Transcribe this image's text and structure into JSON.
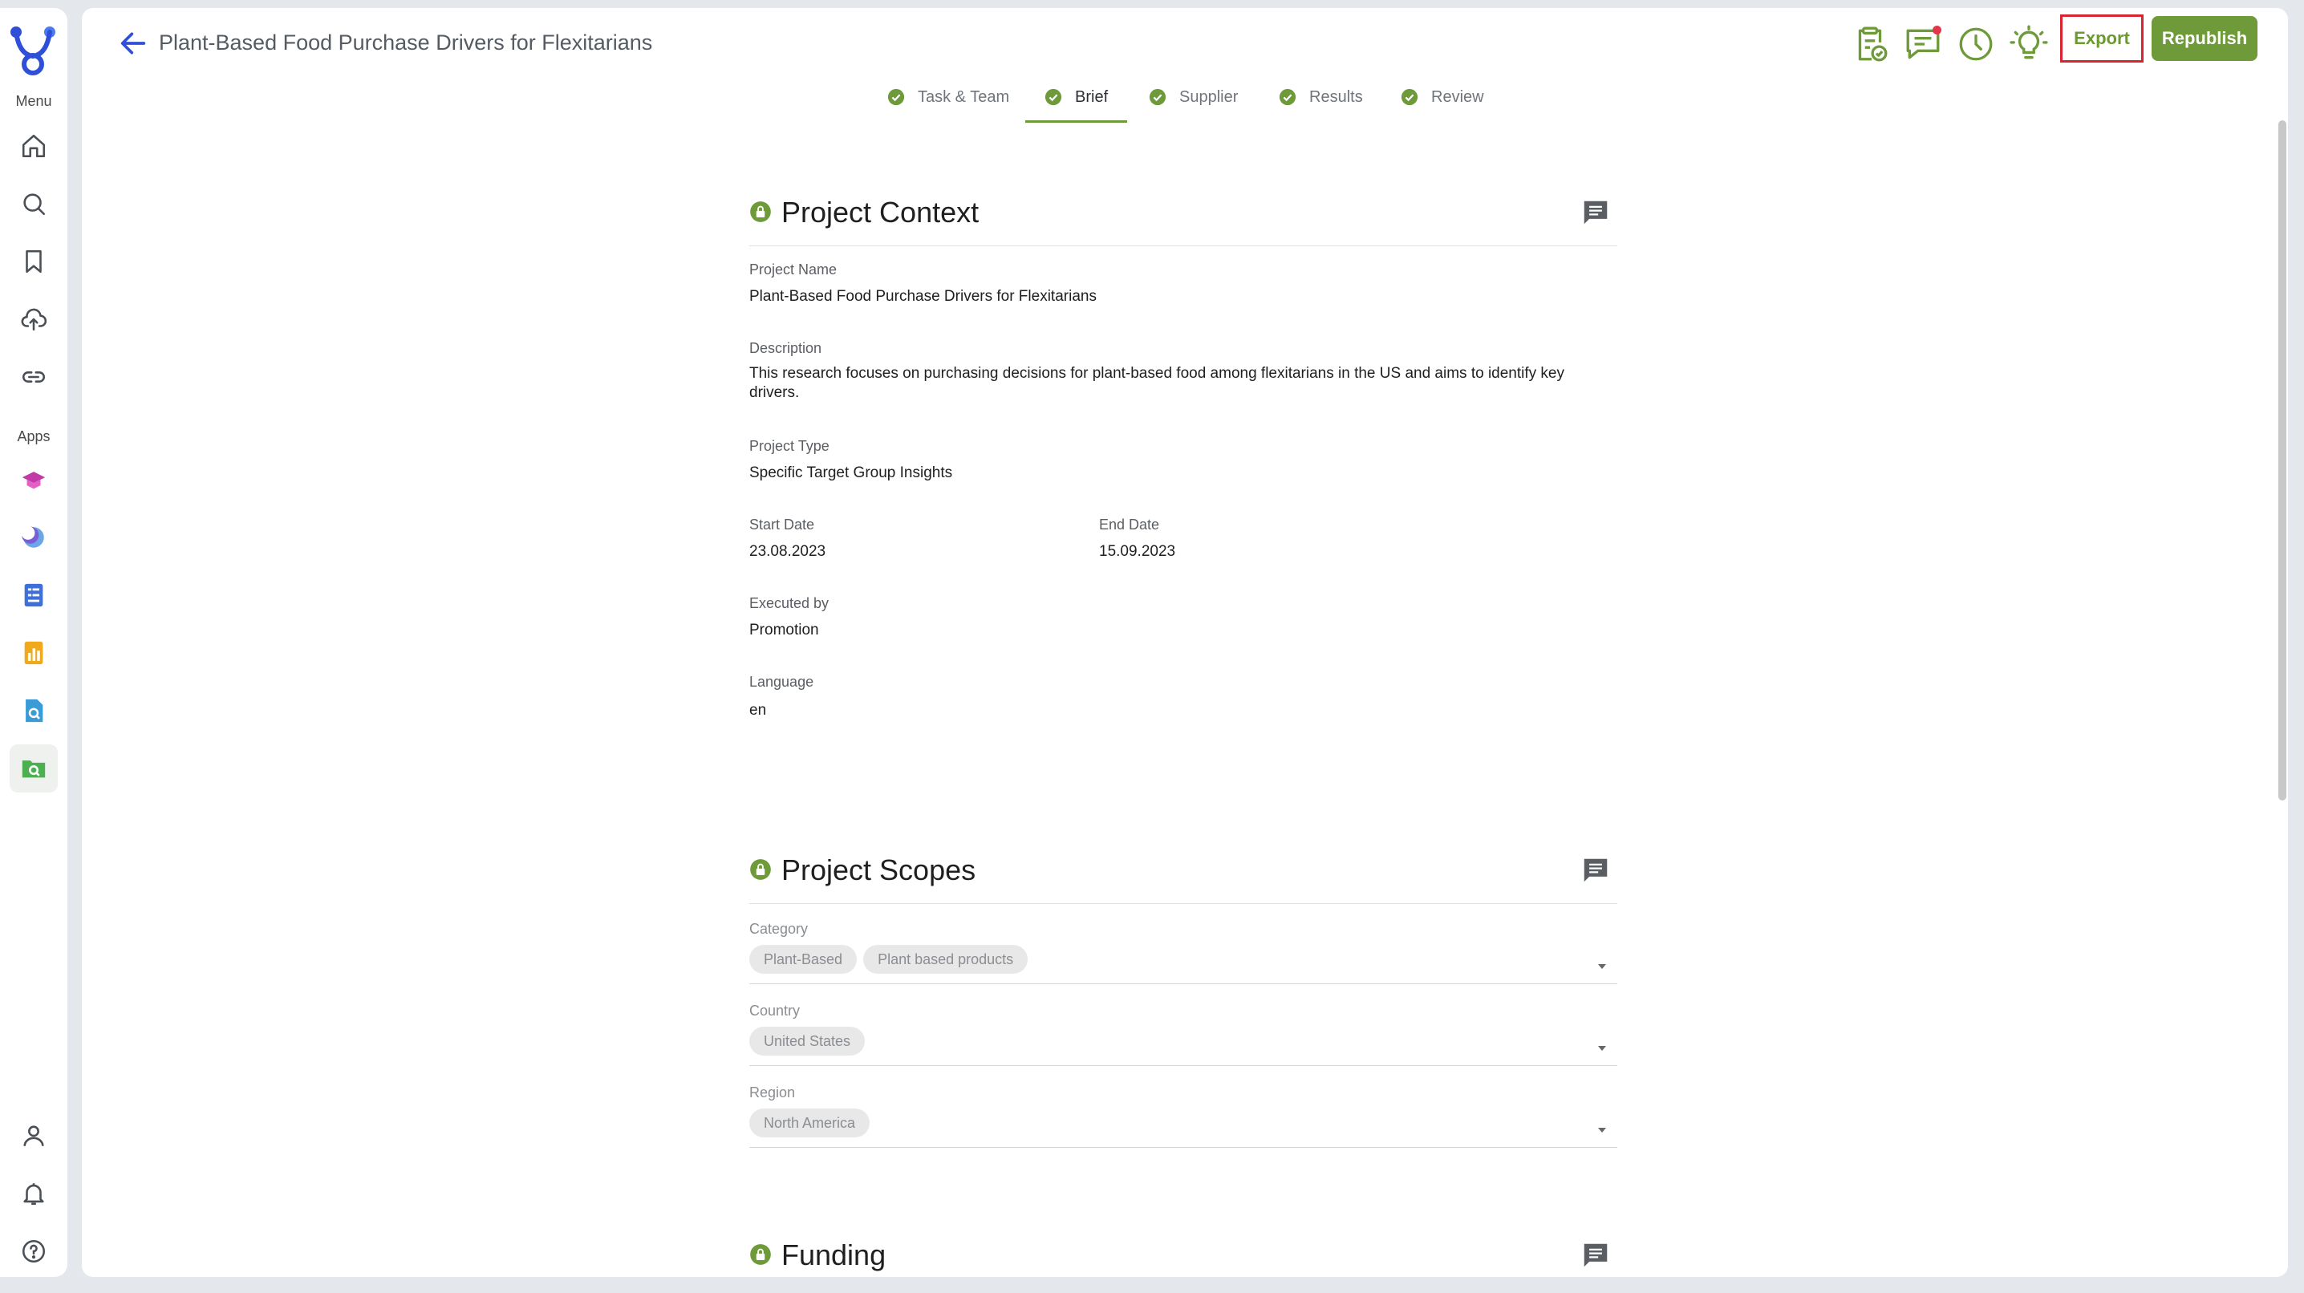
{
  "sidebar": {
    "menu_label": "Menu",
    "apps_label": "Apps",
    "menu_items": [
      {
        "name": "home-icon"
      },
      {
        "name": "search-icon"
      },
      {
        "name": "bookmark-icon"
      },
      {
        "name": "upload-icon"
      },
      {
        "name": "link-icon"
      }
    ],
    "app_items": [
      {
        "name": "graduation-cap-app-icon"
      },
      {
        "name": "moon-app-icon"
      },
      {
        "name": "document-list-app-icon"
      },
      {
        "name": "bar-chart-app-icon"
      },
      {
        "name": "document-search-app-icon"
      },
      {
        "name": "folder-search-app-icon"
      }
    ],
    "bottom_items": [
      {
        "name": "profile-icon"
      },
      {
        "name": "bell-icon"
      },
      {
        "name": "help-icon"
      }
    ]
  },
  "header": {
    "title": "Plant-Based Food Purchase Drivers for Flexitarians",
    "export_label": "Export",
    "republish_label": "Republish",
    "icons": [
      "clipboard-check-icon",
      "chat-icon",
      "clock-icon",
      "lightbulb-icon"
    ]
  },
  "tabs": [
    {
      "label": "Task & Team"
    },
    {
      "label": "Brief",
      "active": true
    },
    {
      "label": "Supplier"
    },
    {
      "label": "Results"
    },
    {
      "label": "Review"
    }
  ],
  "project_context": {
    "title": "Project Context",
    "project_name_label": "Project Name",
    "project_name": "Plant-Based Food Purchase Drivers for Flexitarians",
    "description_label": "Description",
    "description": "This research focuses on purchasing decisions for plant-based food among flexitarians in the US and aims to identify key drivers.",
    "project_type_label": "Project Type",
    "project_type": "Specific Target Group Insights",
    "start_date_label": "Start Date",
    "start_date": "23.08.2023",
    "end_date_label": "End Date",
    "end_date": "15.09.2023",
    "executed_by_label": "Executed by",
    "executed_by": "Promotion",
    "language_label": "Language",
    "language": "en"
  },
  "project_scopes": {
    "title": "Project Scopes",
    "category_label": "Category",
    "categories": [
      "Plant-Based",
      "Plant based products"
    ],
    "country_label": "Country",
    "countries": [
      "United States"
    ],
    "region_label": "Region",
    "regions": [
      "North America"
    ]
  },
  "funding": {
    "title": "Funding"
  },
  "colors": {
    "accent_green": "#6e9a3a",
    "export_highlight": "#d9232e",
    "brand_blue": "#2f4fd8"
  }
}
